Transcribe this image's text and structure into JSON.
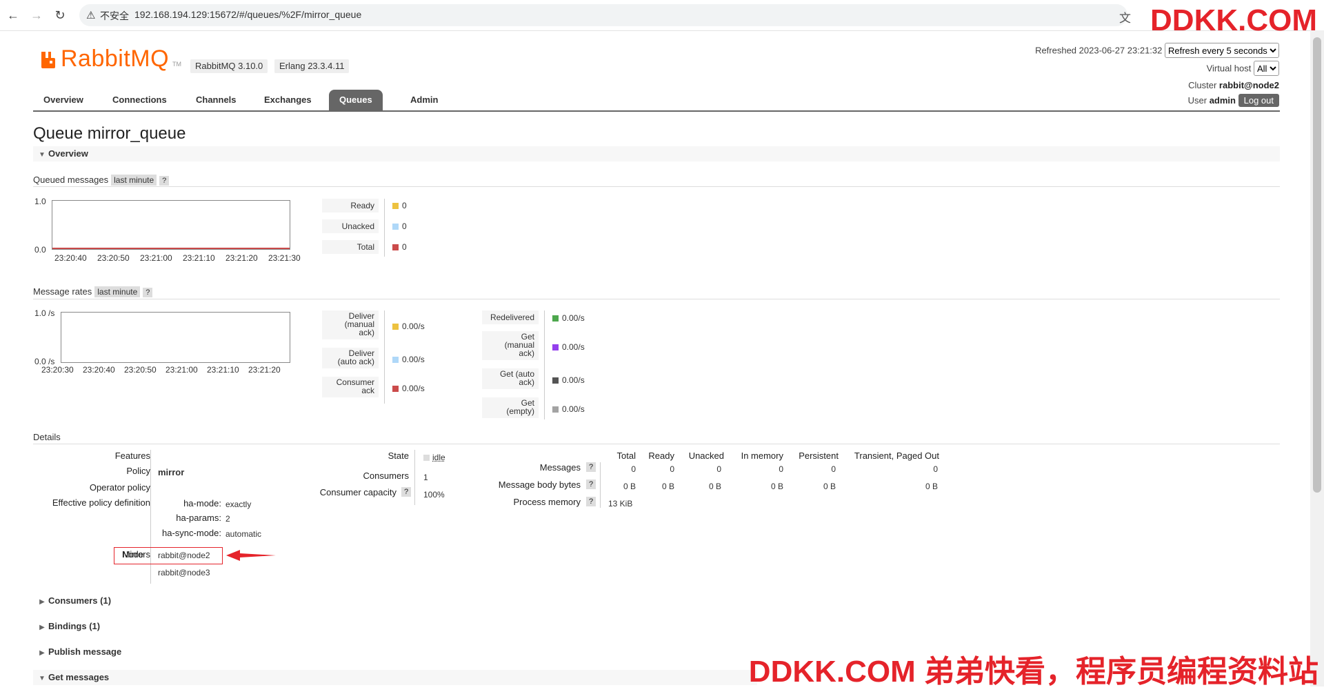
{
  "browser": {
    "warning": "不安全",
    "url": "192.168.194.129:15672/#/queues/%2F/mirror_queue"
  },
  "watermarks": {
    "top": "DDKK.COM",
    "bottom": "DDKK.COM 弟弟快看，程序员编程资料站"
  },
  "header": {
    "logo_text": "RabbitMQ",
    "logo_tm": "TM",
    "rabbitmq_version": "RabbitMQ 3.10.0",
    "erlang_version": "Erlang 23.3.4.11",
    "refreshed": "Refreshed 2023-06-27 23:21:32",
    "refresh_option": "Refresh every 5 seconds",
    "virtual_host_label": "Virtual host",
    "virtual_host_value": "All",
    "cluster_label": "Cluster",
    "cluster_value": "rabbit@node2",
    "user_label": "User",
    "user_value": "admin",
    "logout": "Log out"
  },
  "tabs": [
    "Overview",
    "Connections",
    "Channels",
    "Exchanges",
    "Queues",
    "Admin"
  ],
  "page": {
    "title_prefix": "Queue",
    "title_name": "mirror_queue"
  },
  "overview": {
    "header": "Overview",
    "queued": {
      "label": "Queued messages",
      "range": "last minute",
      "help": "?",
      "y_top": "1.0",
      "y_bottom": "0.0",
      "x_ticks": [
        "23:20:40",
        "23:20:50",
        "23:21:00",
        "23:21:10",
        "23:21:20",
        "23:21:30"
      ],
      "legend": [
        {
          "label": "Ready",
          "value": "0",
          "color": "#edc240"
        },
        {
          "label": "Unacked",
          "value": "0",
          "color": "#afd8f8"
        },
        {
          "label": "Total",
          "value": "0",
          "color": "#cb4b4b"
        }
      ]
    },
    "rates": {
      "label": "Message rates",
      "range": "last minute",
      "help": "?",
      "y_top": "1.0 /s",
      "y_bottom": "0.0 /s",
      "x_ticks": [
        "23:20:30",
        "23:20:40",
        "23:20:50",
        "23:21:00",
        "23:21:10",
        "23:21:20"
      ],
      "legend_left": [
        {
          "label": "Deliver\n(manual\nack)",
          "value": "0.00/s",
          "color": "#edc240"
        },
        {
          "label": "Deliver\n(auto ack)",
          "value": "0.00/s",
          "color": "#afd8f8"
        },
        {
          "label": "Consumer\nack",
          "value": "0.00/s",
          "color": "#cb4b4b"
        }
      ],
      "legend_right": [
        {
          "label": "Redelivered",
          "value": "0.00/s",
          "color": "#4da74d"
        },
        {
          "label": "Get\n(manual\nack)",
          "value": "0.00/s",
          "color": "#9440ed"
        },
        {
          "label": "Get (auto\nack)",
          "value": "0.00/s",
          "color": "#545454"
        },
        {
          "label": "Get\n(empty)",
          "value": "0.00/s",
          "color": "#a3a3a3"
        }
      ]
    }
  },
  "details": {
    "label": "Details",
    "features_label": "Features",
    "policy_label": "Policy",
    "policy_value": "mirror",
    "operator_policy_label": "Operator policy",
    "effective_policy_label": "Effective policy definition",
    "ha_mode_label": "ha-mode:",
    "ha_mode_value": "exactly",
    "ha_params_label": "ha-params:",
    "ha_params_value": "2",
    "ha_sync_label": "ha-sync-mode:",
    "ha_sync_value": "automatic",
    "node_label": "Node",
    "node_value": "rabbit@node2",
    "mirrors_label": "Mirrors",
    "mirrors_value": "rabbit@node3",
    "state_label": "State",
    "state_value": "idle",
    "consumers_label": "Consumers",
    "consumers_value": "1",
    "capacity_label": "Consumer capacity",
    "capacity_value": "100%",
    "help": "?",
    "stats_headers": [
      "Total",
      "Ready",
      "Unacked",
      "In memory",
      "Persistent",
      "Transient, Paged Out"
    ],
    "messages_label": "Messages",
    "messages_values": [
      "0",
      "0",
      "0",
      "0",
      "0",
      "0"
    ],
    "body_bytes_label": "Message body bytes",
    "body_bytes_values": [
      "0 B",
      "0 B",
      "0 B",
      "0 B",
      "0 B",
      "0 B"
    ],
    "process_memory_label": "Process memory",
    "process_memory_value": "13 KiB"
  },
  "sections": {
    "consumers": "Consumers (1)",
    "bindings": "Bindings (1)",
    "publish": "Publish message",
    "get": "Get messages"
  },
  "colors": {
    "accent": "#ff6600",
    "tab_active": "#666666",
    "annotation": "#e5232a"
  }
}
